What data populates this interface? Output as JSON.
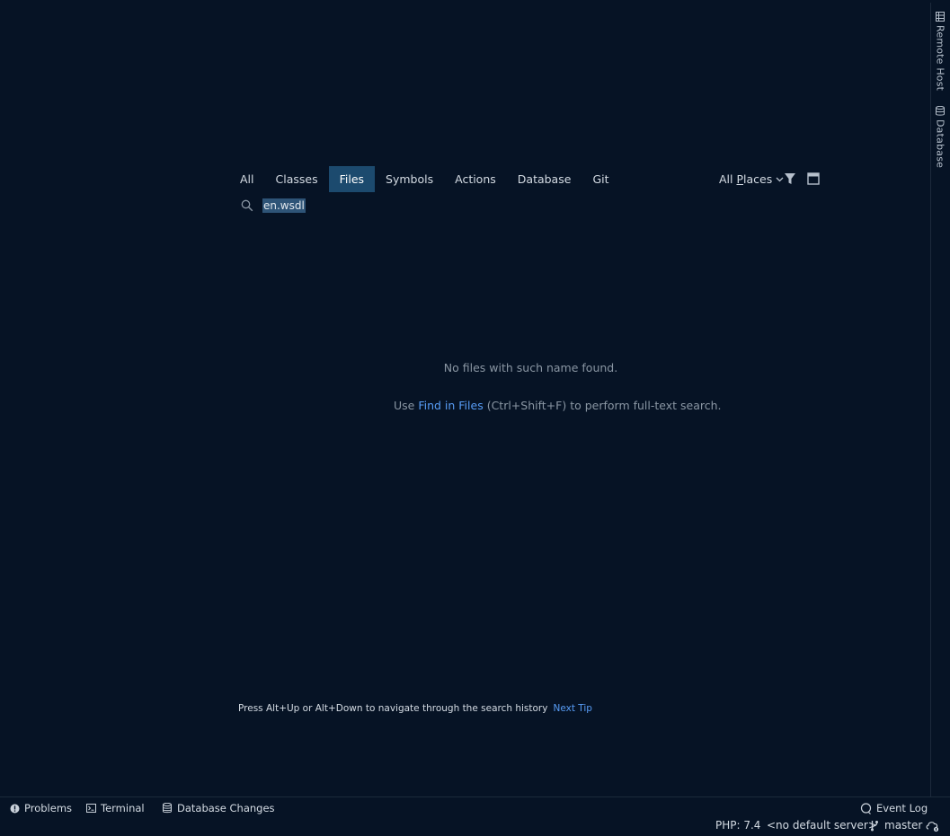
{
  "right_tools": [
    {
      "label": "Remote Host",
      "icon": "server-icon"
    },
    {
      "label": "Database",
      "icon": "database-icon"
    }
  ],
  "search_popup": {
    "tabs": [
      {
        "label": "All"
      },
      {
        "label": "Classes"
      },
      {
        "label": "Files"
      },
      {
        "label": "Symbols"
      },
      {
        "label": "Actions"
      },
      {
        "label": "Database"
      },
      {
        "label": "Git"
      }
    ],
    "active_tab": "Files",
    "scope": {
      "prefix": "All ",
      "mnemonic": "P",
      "suffix": "laces"
    },
    "query": "en.wsdl",
    "empty_message": "No files with such name found.",
    "hint": {
      "before": "Use ",
      "link": "Find in Files",
      "after": " (Ctrl+Shift+F) to perform full-text search."
    },
    "tip": {
      "text": "Press Alt+Up or Alt+Down to navigate through the search history",
      "link": "Next Tip"
    }
  },
  "bottom_tools": [
    {
      "label": "Problems",
      "icon": "problems-icon"
    },
    {
      "label": "Terminal",
      "icon": "terminal-icon"
    },
    {
      "label": "Database Changes",
      "icon": "database-changes-icon"
    }
  ],
  "event_log": {
    "label": "Event Log",
    "icon": "event-log-icon"
  },
  "status": {
    "php": "PHP: 7.4",
    "server": "<no default server>",
    "branch": "master"
  },
  "colors": {
    "background": "#061325",
    "active_tab": "#1c4a6e",
    "link": "#589df6",
    "muted_text": "#8a96a3"
  }
}
